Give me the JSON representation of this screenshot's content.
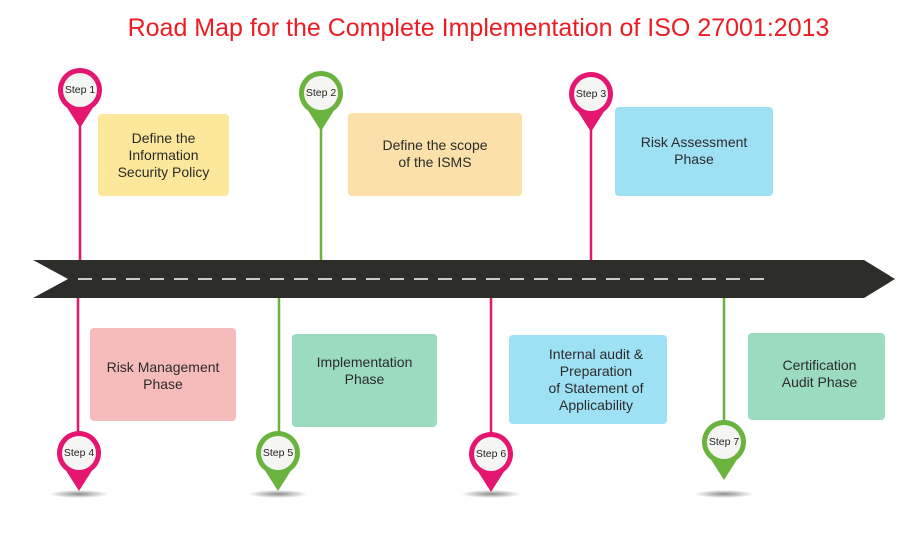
{
  "title": "Road Map for the Complete Implementation of ISO 27001:2013",
  "colors": {
    "title": "#ec1c24",
    "road": "#2d2e2a",
    "road_dash": "#ffffff",
    "pink": "#e5166f",
    "green": "#6ab33e",
    "yellow_box": "#fde79b",
    "peach_box": "#fbe0a9",
    "blue_box": "#9fe1f4",
    "pink_box": "#f6bcbb",
    "green_box": "#9bdcc0"
  },
  "steps": [
    {
      "label": "Step 1",
      "text": "Define the\nInformation\nSecurity Policy",
      "pin_color": "pink",
      "box_color": "yellow",
      "side": "top"
    },
    {
      "label": "Step 2",
      "text": "Define the scope\nof the ISMS",
      "pin_color": "green",
      "box_color": "peach",
      "side": "top"
    },
    {
      "label": "Step 3",
      "text": "Risk Assessment\nPhase",
      "pin_color": "pink",
      "box_color": "blue",
      "side": "top"
    },
    {
      "label": "Step 4",
      "text": "Risk Management\nPhase",
      "pin_color": "pink",
      "box_color": "pink",
      "side": "bottom"
    },
    {
      "label": "Step 5",
      "text": "Implementation\nPhase",
      "pin_color": "green",
      "box_color": "green",
      "side": "bottom"
    },
    {
      "label": "Step 6",
      "text": "Internal audit &\nPreparation\nof Statement of\nApplicability",
      "pin_color": "pink",
      "box_color": "blue",
      "side": "bottom"
    },
    {
      "label": "Step 7",
      "text": "Certification\nAudit Phase",
      "pin_color": "green",
      "box_color": "green",
      "side": "bottom"
    }
  ]
}
